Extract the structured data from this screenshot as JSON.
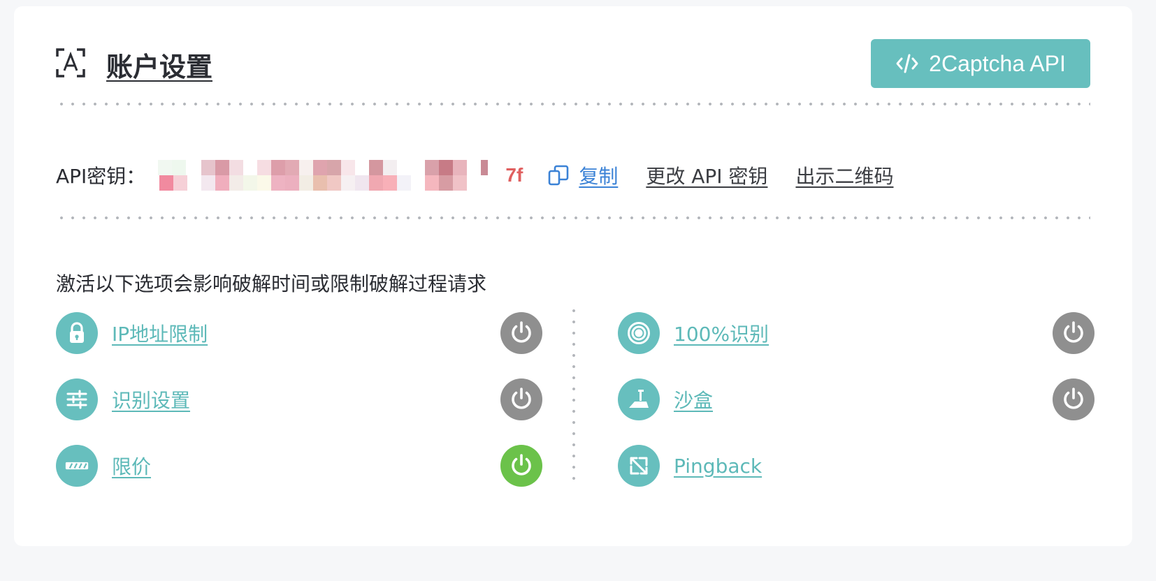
{
  "header": {
    "title": "账户设置",
    "icon": "text-recognition-icon",
    "api_button_label": "2Captcha API",
    "api_button_icon": "code-icon"
  },
  "api_key": {
    "label": "API密钥：",
    "value_visible_tail": "7f",
    "copy_label": "复制",
    "change_label": "更改 API 密钥",
    "qr_label": "出示二维码"
  },
  "options_notice": "激活以下选项会影响破解时间或限制破解过程请求",
  "options": {
    "left": [
      {
        "label": "IP地址限制",
        "icon": "lock-icon",
        "enabled": false
      },
      {
        "label": "识别设置",
        "icon": "sliders-icon",
        "enabled": false
      },
      {
        "label": "限价",
        "icon": "price-limit-icon",
        "enabled": true
      }
    ],
    "right": [
      {
        "label": "100%识别",
        "icon": "target-icon",
        "enabled": false
      },
      {
        "label": "沙盒",
        "icon": "sandbox-shovel-icon",
        "enabled": false
      },
      {
        "label": "Pingback",
        "icon": "arrows-diagonal-icon",
        "enabled": null
      }
    ]
  },
  "colors": {
    "accent": "#67bfbe",
    "toggle_off": "#8f8f8f",
    "toggle_on": "#6bc24a",
    "link_blue": "#3b82d6",
    "key_tail": "#e05f5f"
  }
}
